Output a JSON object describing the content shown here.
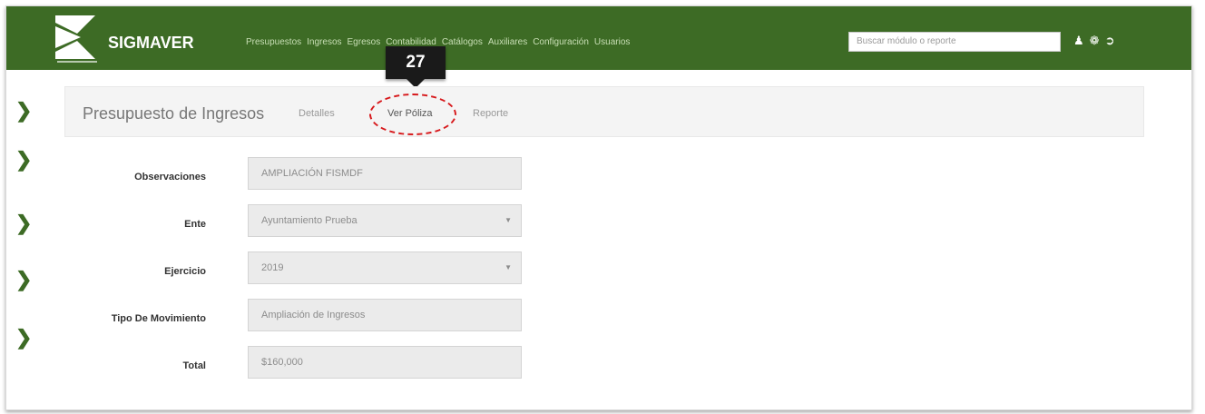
{
  "header": {
    "brand": "SIGMAVER",
    "nav_items": [
      "Presupuestos",
      "Ingresos",
      "Egresos",
      "Contabilidad",
      "Catálogos",
      "Auxiliares",
      "Configuración",
      "Usuarios"
    ],
    "search_placeholder": "Buscar módulo o reporte",
    "colors": {
      "bar": "#3d6b25",
      "accent": "#d7191c"
    }
  },
  "callout": {
    "number": "27"
  },
  "subheader": {
    "title": "Presupuesto de Ingresos",
    "tabs": [
      "Detalles",
      "Ver Póliza",
      "Reporte"
    ]
  },
  "form": {
    "fields": [
      {
        "label": "Observaciones",
        "value": "AMPLIACIÓN FISMDF"
      },
      {
        "label": "Ente",
        "value": "Ayuntamiento Prueba"
      },
      {
        "label": "Ejercicio",
        "value": "2019"
      },
      {
        "label": "Tipo De Movimiento",
        "value": "Ampliación de Ingresos"
      },
      {
        "label": "Total",
        "value": "$160,000"
      }
    ]
  },
  "icons": [
    "chevron-right-icon",
    "user-icon",
    "settings-icon",
    "logout-icon"
  ]
}
